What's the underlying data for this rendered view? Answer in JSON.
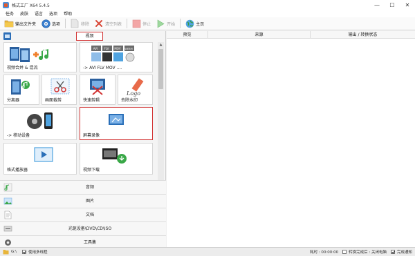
{
  "window": {
    "title": "格式工厂 X64 5.4.5",
    "minimize": "—",
    "maximize": "☐",
    "close": "✕"
  },
  "menu": [
    "任务",
    "皮肤",
    "语言",
    "选项",
    "帮助"
  ],
  "toolbar": {
    "output_folder": "输出文件夹",
    "options": "选项",
    "remove": "移除",
    "clear_list": "清空列表",
    "stop": "停止",
    "start": "开始",
    "home": "主页"
  },
  "left": {
    "category_label": "视频",
    "tiles": [
      {
        "label": "视频合并 & 混流"
      },
      {
        "label": "-> AVI FLV MOV ....",
        "formats": [
          "AVI",
          "FLV",
          "MOV",
          "WEBM"
        ]
      },
      {
        "label": "分离器"
      },
      {
        "label": "画面裁剪"
      },
      {
        "label": "快速剪辑"
      },
      {
        "label": "去除水印",
        "logo_text": "Logo"
      },
      {
        "label": "-> 移动设备"
      },
      {
        "label": "屏幕录像"
      },
      {
        "label": "格式播放器"
      },
      {
        "label": "视频下载"
      }
    ],
    "scroll_up": "▲",
    "scroll_down": "▼",
    "categories": [
      "音频",
      "图片",
      "文档",
      "光驱设备\\DVD\\CD\\ISO",
      "工具集"
    ]
  },
  "right": {
    "columns": [
      "预览",
      "来源",
      "输出 / 转换状态"
    ]
  },
  "status": {
    "multithread": "使用多线程",
    "elapsed": "耗时 : 00:00:00",
    "after_convert": "转换完成后 : 关闭电脑",
    "notify": "完成通知"
  },
  "colors": {
    "highlight": "#d23434",
    "accent": "#2d6fb8"
  }
}
